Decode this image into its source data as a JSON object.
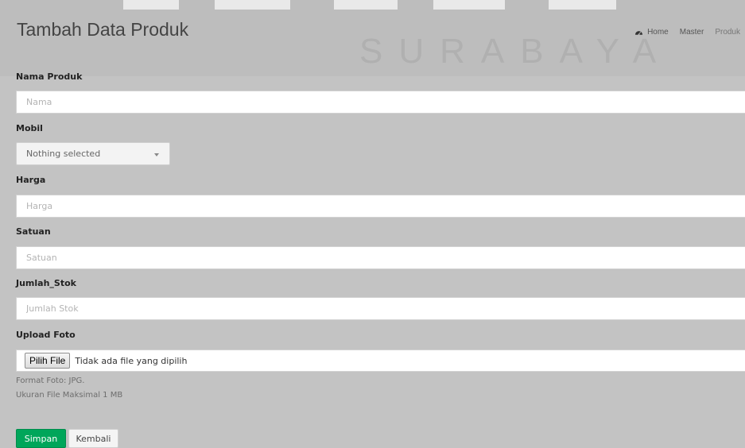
{
  "header": {
    "title": "Tambah Data Produk",
    "watermark": "SURABAYA",
    "breadcrumb": [
      {
        "label": "Home",
        "icon": "dashboard-icon"
      },
      {
        "label": "Master"
      },
      {
        "label": "Produk"
      }
    ]
  },
  "form": {
    "nama_produk": {
      "label": "Nama Produk",
      "placeholder": "Nama",
      "value": ""
    },
    "mobil": {
      "label": "Mobil",
      "selected": "Nothing selected",
      "icon": "caret-down-icon"
    },
    "harga": {
      "label": "Harga",
      "placeholder": "Harga",
      "value": ""
    },
    "satuan": {
      "label": "Satuan",
      "placeholder": "Satuan",
      "value": ""
    },
    "jumlah_stok": {
      "label": "Jumlah_Stok",
      "placeholder": "Jumlah Stok",
      "value": ""
    },
    "upload_foto": {
      "label": "Upload Foto",
      "button_label": "Pilih File",
      "status": "Tidak ada file yang dipilih",
      "help_format": "Format Foto: JPG.",
      "help_size": "Ukuran File Maksimal 1 MB"
    }
  },
  "actions": {
    "save_label": "Simpan",
    "back_label": "Kembali"
  },
  "colors": {
    "page_bg": "#c3c3c3",
    "save_button": "#00a65a"
  }
}
